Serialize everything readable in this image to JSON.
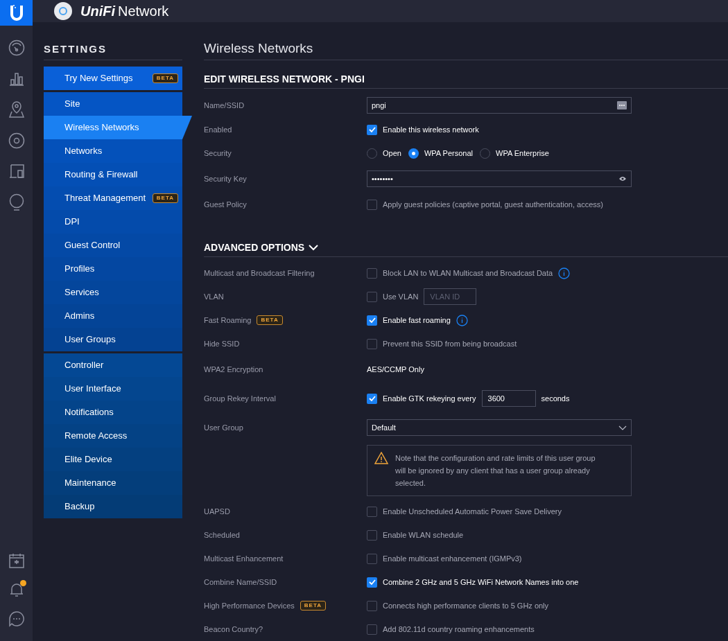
{
  "header": {
    "brand": "UniFi",
    "product": "Network"
  },
  "settings_menu": {
    "title": "SETTINGS",
    "groups": [
      [
        {
          "label": "Try New Settings",
          "badge": "BETA",
          "selected": false
        }
      ],
      [
        {
          "label": "Site",
          "selected": false
        },
        {
          "label": "Wireless Networks",
          "selected": true
        },
        {
          "label": "Networks",
          "selected": false
        },
        {
          "label": "Routing & Firewall",
          "selected": false
        },
        {
          "label": "Threat Management",
          "badge": "BETA",
          "selected": false
        },
        {
          "label": "DPI",
          "selected": false
        },
        {
          "label": "Guest Control",
          "selected": false
        },
        {
          "label": "Profiles",
          "selected": false
        },
        {
          "label": "Services",
          "selected": false
        },
        {
          "label": "Admins",
          "selected": false
        },
        {
          "label": "User Groups",
          "selected": false
        }
      ],
      [
        {
          "label": "Controller",
          "selected": false
        },
        {
          "label": "User Interface",
          "selected": false
        },
        {
          "label": "Notifications",
          "selected": false
        },
        {
          "label": "Remote Access",
          "selected": false
        },
        {
          "label": "Elite Device",
          "selected": false
        },
        {
          "label": "Maintenance",
          "selected": false
        },
        {
          "label": "Backup",
          "selected": false
        }
      ]
    ]
  },
  "page_title": "Wireless Networks",
  "sections": [
    {
      "title": "EDIT WIRELESS NETWORK - PNGI",
      "rows": [
        {
          "kind": "input",
          "label": "Name/SSID",
          "value": "pngi"
        },
        {
          "kind": "checkbox",
          "label": "Enabled",
          "text": "Enable this wireless network",
          "checked": true
        },
        {
          "kind": "radio",
          "label": "Security",
          "options": [
            {
              "label": "Open",
              "selected": false
            },
            {
              "label": "WPA Personal",
              "selected": true
            },
            {
              "label": "WPA Enterprise",
              "selected": false
            }
          ]
        },
        {
          "kind": "password",
          "label": "Security Key",
          "value": "••••••••"
        },
        {
          "kind": "checkbox",
          "label": "Guest Policy",
          "text": "Apply guest policies (captive portal, guest authentication, access)",
          "checked": false
        }
      ]
    },
    {
      "title": "ADVANCED OPTIONS",
      "expanded": true,
      "rows": [
        {
          "kind": "checkbox",
          "label": "Multicast and Broadcast Filtering",
          "text": "Block LAN to WLAN Multicast and Broadcast Data",
          "checked": false,
          "info": true
        },
        {
          "kind": "checkbox",
          "label": "VLAN",
          "text": "Use VLAN",
          "checked": false,
          "field": {
            "placeholder": "VLAN ID"
          }
        },
        {
          "kind": "checkbox",
          "label": "Fast Roaming",
          "badge": "BETA",
          "text": "Enable fast roaming",
          "checked": true,
          "info": true
        },
        {
          "kind": "checkbox",
          "label": "Hide SSID",
          "text": "Prevent this SSID from being broadcast",
          "checked": false
        },
        {
          "kind": "static",
          "label": "WPA2 Encryption",
          "value": "AES/CCMP Only"
        },
        {
          "kind": "checkbox",
          "label": "Group Rekey Interval",
          "text": "Enable GTK rekeying every",
          "checked": true,
          "field": {
            "value": "3600"
          },
          "suffix": "seconds"
        },
        {
          "kind": "select",
          "label": "User Group",
          "value": "Default"
        },
        {
          "kind": "note",
          "text": "Note that the configuration and rate limits of this user group will be ignored by any client that has a user group already selected."
        },
        {
          "kind": "checkbox",
          "label": "UAPSD",
          "text": "Enable Unscheduled Automatic Power Save Delivery",
          "checked": false
        },
        {
          "kind": "checkbox",
          "label": "Scheduled",
          "text": "Enable WLAN schedule",
          "checked": false
        },
        {
          "kind": "checkbox",
          "label": "Multicast Enhancement",
          "text": "Enable multicast enhancement (IGMPv3)",
          "checked": false
        },
        {
          "kind": "checkbox",
          "label": "Combine Name/SSID",
          "text": "Combine 2 GHz and 5 GHz WiFi Network Names into one",
          "checked": true
        },
        {
          "kind": "checkbox",
          "label": "High Performance Devices",
          "badge": "BETA",
          "text": "Connects high performance clients to 5 GHz only",
          "checked": false
        },
        {
          "kind": "checkbox",
          "label": "Beacon Country?",
          "text": "Add 802.11d country roaming enhancements",
          "checked": false
        }
      ]
    }
  ],
  "notifications": {
    "unread": true
  }
}
